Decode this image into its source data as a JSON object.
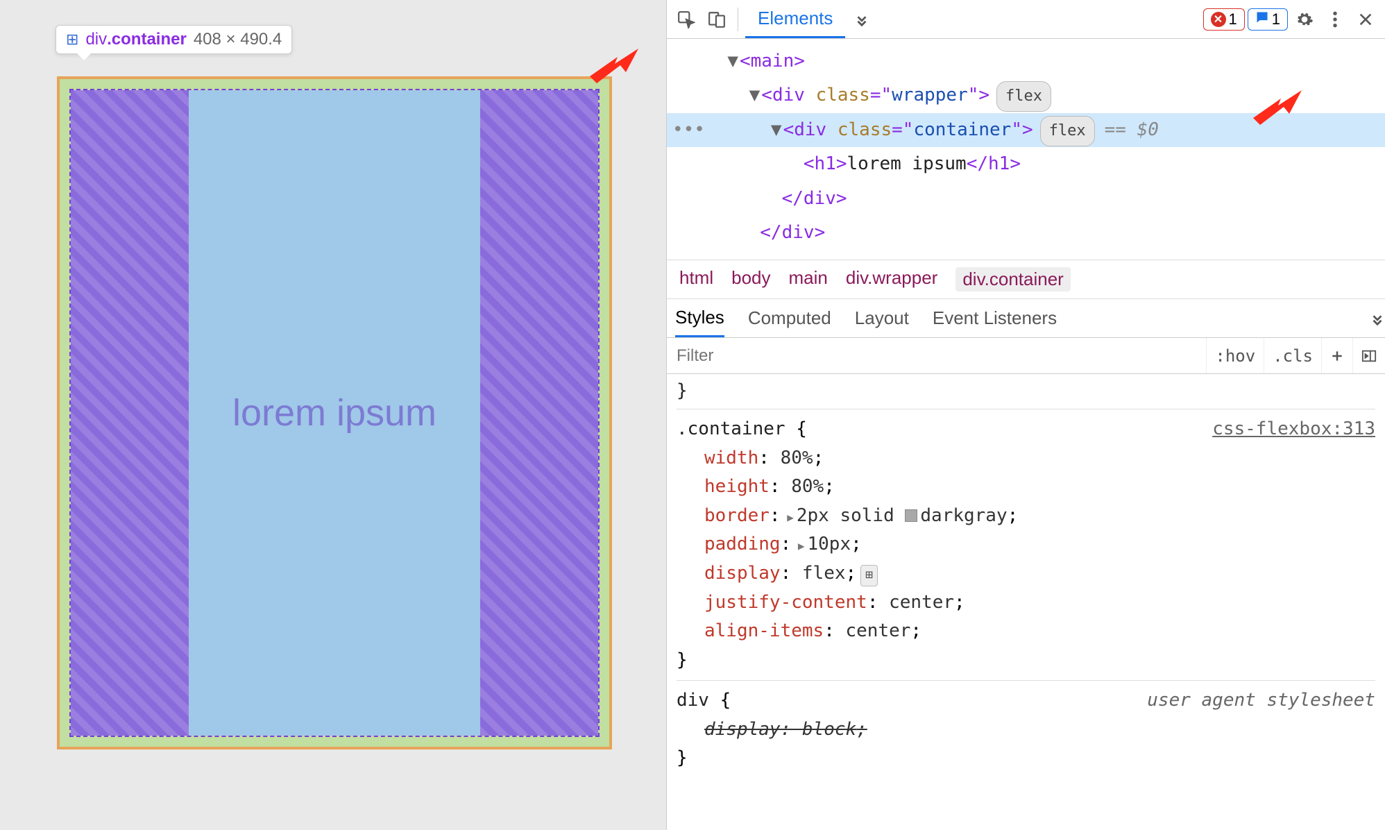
{
  "tooltip": {
    "icon": "⊞",
    "tag_prefix": "div",
    "tag_class": ".container",
    "dimensions": "408 × 490.4"
  },
  "viewport": {
    "heading": "lorem ipsum"
  },
  "toolbar": {
    "tabs": {
      "elements": "Elements"
    },
    "error_count": "1",
    "message_count": "1"
  },
  "dom": {
    "l1_tag": "main",
    "l2_tag": "div",
    "l2_attr": "class",
    "l2_val": "wrapper",
    "l2_pill": "flex",
    "l3_tag": "div",
    "l3_attr": "class",
    "l3_val": "container",
    "l3_pill": "flex",
    "l3_end": "== $0",
    "l4_open": "h1",
    "l4_text": "lorem ipsum",
    "l4_close": "h1",
    "l5_close": "div",
    "l6_close": "div"
  },
  "breadcrumb": [
    "html",
    "body",
    "main",
    "div.wrapper",
    "div.container"
  ],
  "styles_tabs": {
    "styles": "Styles",
    "computed": "Computed",
    "layout": "Layout",
    "listeners": "Event Listeners"
  },
  "filter": {
    "placeholder": "Filter",
    "hov": ":hov",
    "cls": ".cls"
  },
  "rules": {
    "r1_selector": ".container",
    "r1_source": "css-flexbox:313",
    "r1_p1_name": "width",
    "r1_p1_val": "80%",
    "r1_p2_name": "height",
    "r1_p2_val": "80%",
    "r1_p3_name": "border",
    "r1_p3_val_a": "2px solid",
    "r1_p3_val_b": "darkgray",
    "r1_p4_name": "padding",
    "r1_p4_val": "10px",
    "r1_p5_name": "display",
    "r1_p5_val": "flex",
    "r1_p6_name": "justify-content",
    "r1_p6_val": "center",
    "r1_p7_name": "align-items",
    "r1_p7_val": "center",
    "r2_selector": "div",
    "r2_source": "user agent stylesheet",
    "r2_p1_name": "display",
    "r2_p1_val": "block"
  }
}
